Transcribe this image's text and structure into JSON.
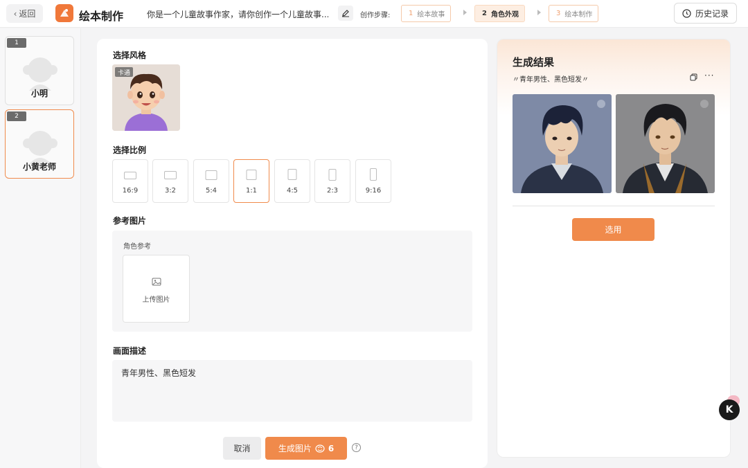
{
  "header": {
    "back_label": "返回",
    "app_title": "绘本制作",
    "prompt_preview": "你是一个儿童故事作家，请你创作一个儿童故事...",
    "steps_label": "创作步骤:",
    "steps": [
      {
        "num": "1",
        "label": "绘本故事"
      },
      {
        "num": "2",
        "label": "角色外观"
      },
      {
        "num": "3",
        "label": "绘本制作"
      }
    ],
    "active_step": "2",
    "history_label": "历史记录"
  },
  "sidebar": {
    "characters": [
      {
        "num": "1",
        "name": "小明"
      },
      {
        "num": "2",
        "name": "小黄老师"
      }
    ],
    "selected_index": 1
  },
  "form": {
    "style_section": "选择风格",
    "style_tag": "卡通",
    "ratio_section": "选择比例",
    "ratios": [
      "16:9",
      "3:2",
      "5:4",
      "1:1",
      "4:5",
      "2:3",
      "9:16"
    ],
    "selected_ratio": "1:1",
    "reference_section": "参考图片",
    "reference_sub": "角色参考",
    "upload_label": "上传图片",
    "description_section": "画面描述",
    "description_value": "青年男性、黑色短发",
    "cancel_label": "取消",
    "generate_label": "生成图片",
    "generate_cost": "6",
    "help_symbol": "?"
  },
  "result": {
    "title": "生成结果",
    "prompt": "〃青年男性、黑色短发〃",
    "more_symbol": "···",
    "use_label": "选用"
  },
  "floating": {
    "label": "K"
  },
  "colors": {
    "accent": "#f08a4b",
    "accent_light": "#fdeee2"
  }
}
